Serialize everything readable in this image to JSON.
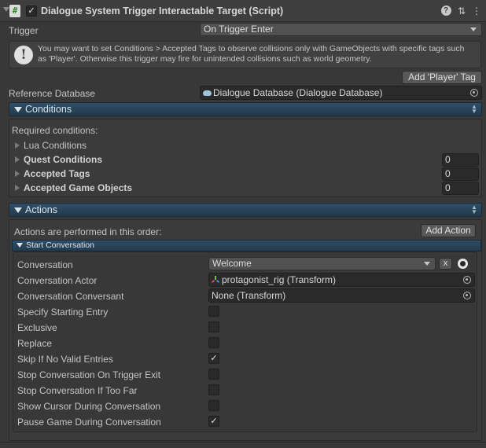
{
  "component": {
    "title": "Dialogue System Trigger Interactable Target (Script)",
    "enabled_check": "✓",
    "script_icon": "#",
    "help_icon": "?",
    "settings_icon": "⇅",
    "menu_icon": "⋮"
  },
  "trigger": {
    "label": "Trigger",
    "value": "On Trigger Enter",
    "help_text": "You may want to set Conditions > Accepted Tags to observe collisions only with GameObjects with specific tags such as 'Player'. Otherwise this trigger may fire for unintended collisions such as world geometry.",
    "add_player_tag": "Add 'Player' Tag"
  },
  "reference_database": {
    "label": "Reference Database",
    "value": "Dialogue Database (Dialogue Database)"
  },
  "conditions": {
    "title": "Conditions",
    "required_label": "Required conditions:",
    "items": [
      {
        "label": "Lua Conditions"
      },
      {
        "label": "Quest Conditions",
        "count": "0"
      },
      {
        "label": "Accepted Tags",
        "count": "0"
      },
      {
        "label": "Accepted Game Objects",
        "count": "0"
      }
    ]
  },
  "actions": {
    "title": "Actions",
    "order_label": "Actions are performed in this order:",
    "add_action": "Add Action",
    "start_conversation": {
      "title": "Start Conversation",
      "conversation_label": "Conversation",
      "conversation_value": "Welcome",
      "clear_button": "x",
      "actor_label": "Conversation Actor",
      "actor_value": "protagonist_rig (Transform)",
      "conversant_label": "Conversation Conversant",
      "conversant_value": "None (Transform)",
      "toggles": [
        {
          "label": "Specify Starting Entry",
          "checked": false
        },
        {
          "label": "Exclusive",
          "checked": false
        },
        {
          "label": "Replace",
          "checked": false
        },
        {
          "label": "Skip If No Valid Entries",
          "checked": true
        },
        {
          "label": "Stop Conversation On Trigger Exit",
          "checked": false
        },
        {
          "label": "Stop Conversation If Too Far",
          "checked": false
        },
        {
          "label": "Show Cursor During Conversation",
          "checked": false
        },
        {
          "label": "Pause Game During Conversation",
          "checked": true
        }
      ],
      "check_glyph": "✓"
    }
  },
  "colors": {
    "section_bar": "#2f4e66",
    "background": "#383838",
    "field": "#2a2a2a"
  }
}
